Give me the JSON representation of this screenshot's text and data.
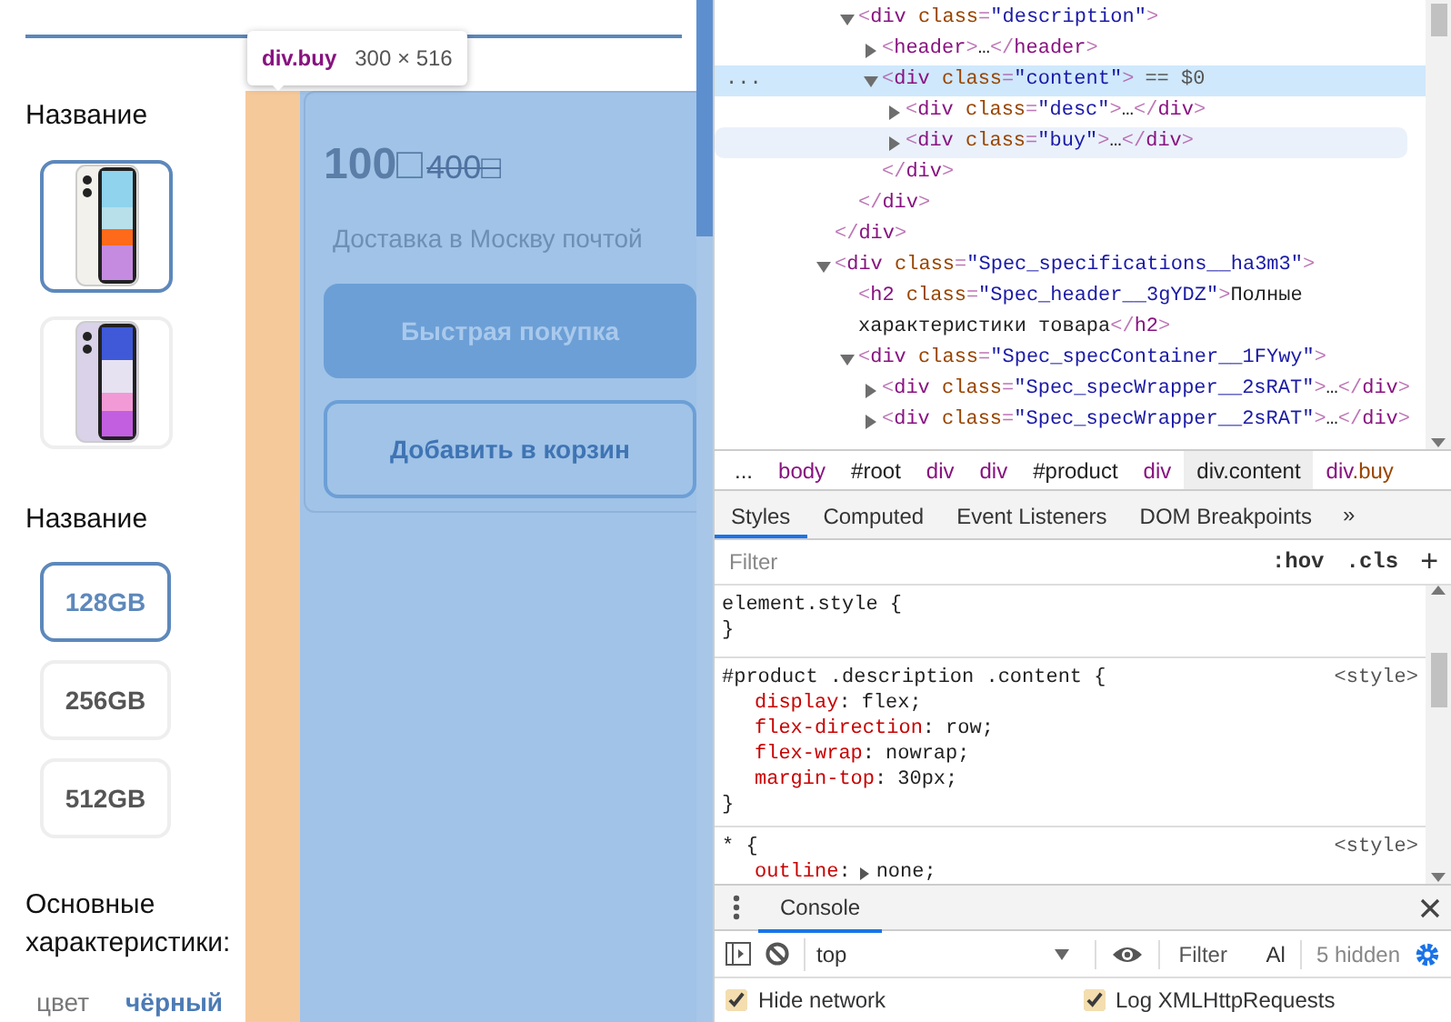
{
  "page": {
    "option_groups": [
      {
        "title": "Название",
        "kind": "image",
        "options": [
          {
            "color": "#f3f1ec",
            "selected": true
          },
          {
            "color": "#d9d2e9",
            "selected": false
          }
        ]
      },
      {
        "title": "Название",
        "kind": "text",
        "options": [
          {
            "label": "128GB",
            "selected": true
          },
          {
            "label": "256GB",
            "selected": false
          },
          {
            "label": "512GB",
            "selected": false
          }
        ]
      }
    ],
    "specs_title": "Основные характеристики:",
    "specs": [
      {
        "name": "цвет",
        "value": "чёрный"
      }
    ]
  },
  "inspect_tooltip": {
    "selector": "div.buy",
    "size": "300 × 516"
  },
  "buy_block": {
    "price": "100□",
    "old_price": "400□",
    "delivery": "Доставка в Москву почтой",
    "buttons": [
      {
        "label": "Быстрая покупка",
        "kind": "primary"
      },
      {
        "label": "Добавить в корзин",
        "kind": "outline"
      }
    ]
  },
  "devtools": {
    "elements_tree": [
      {
        "kind": "continuation",
        "close": "</div>",
        "children": [
          {
            "kind": "element",
            "line": "<div class=\"description\">",
            "expanded": true,
            "selected": false,
            "hovered": false,
            "close": "</div>",
            "children": [
              {
                "kind": "element",
                "line": "<header>…</header>",
                "expanded": false,
                "selected": false,
                "hovered": false
              },
              {
                "kind": "element",
                "line": "<div class=\"content\">",
                "suffix": "== $0",
                "gutter": "...",
                "expanded": true,
                "selected": true,
                "hovered": false,
                "close": "</div>",
                "children": [
                  {
                    "kind": "element",
                    "line": "<div class=\"desc\">…</div>",
                    "expanded": false,
                    "selected": false,
                    "hovered": false
                  },
                  {
                    "kind": "element",
                    "line": "<div class=\"buy\">…</div>",
                    "expanded": false,
                    "selected": false,
                    "hovered": true
                  }
                ]
              }
            ]
          }
        ]
      },
      {
        "kind": "element",
        "line": "<div class=\"Spec_specifications__ha3m3\">",
        "expanded": true,
        "selected": false,
        "hovered": false,
        "children": [
          {
            "kind": "leaf",
            "line": "<h2 class=\"Spec_header__3gYDZ\">Полные характеристики товара</h2>"
          },
          {
            "kind": "element",
            "line": "<div class=\"Spec_specContainer__1FYwy\">",
            "expanded": true,
            "selected": false,
            "hovered": false,
            "children": [
              {
                "kind": "element",
                "line": "<div class=\"Spec_specWrapper__2sRAT\">…</div>",
                "expanded": false,
                "selected": false,
                "hovered": false
              },
              {
                "kind": "element",
                "line": "<div class=\"Spec_specWrapper__2sRAT\">…</div>",
                "expanded": false,
                "selected": false,
                "hovered": false
              }
            ]
          }
        ]
      }
    ],
    "breadcrumbs": [
      {
        "parts": [
          {
            "text": "...",
            "kind": "plain"
          }
        ],
        "selected": false
      },
      {
        "parts": [
          {
            "text": "body",
            "kind": "tag"
          }
        ],
        "selected": false
      },
      {
        "parts": [
          {
            "text": "#root",
            "kind": "plain"
          }
        ],
        "selected": false
      },
      {
        "parts": [
          {
            "text": "div",
            "kind": "tag"
          }
        ],
        "selected": false
      },
      {
        "parts": [
          {
            "text": "div",
            "kind": "tag"
          }
        ],
        "selected": false
      },
      {
        "parts": [
          {
            "text": "#product",
            "kind": "plain"
          }
        ],
        "selected": false
      },
      {
        "parts": [
          {
            "text": "div",
            "kind": "tag"
          }
        ],
        "selected": false
      },
      {
        "parts": [
          {
            "text": "div.content",
            "kind": "plain"
          }
        ],
        "selected": true
      },
      {
        "parts": [
          {
            "text": "div",
            "kind": "tag"
          },
          {
            "text": ".buy",
            "kind": "class"
          }
        ],
        "selected": false
      }
    ],
    "tabs": [
      {
        "label": "Styles",
        "selected": true
      },
      {
        "label": "Computed",
        "selected": false
      },
      {
        "label": "Event Listeners",
        "selected": false
      },
      {
        "label": "DOM Breakpoints",
        "selected": false
      }
    ],
    "more_tabs": "»",
    "filter": {
      "placeholder": "Filter"
    },
    "filter_buttons": [
      ":hov",
      ".cls",
      "+"
    ],
    "rules": [
      {
        "selector": "element.style {",
        "close": "}"
      },
      {
        "selector": "#product .description .content {",
        "source": "<style>",
        "declarations": [
          {
            "name": "display",
            "colon": ":",
            "value": "flex;",
            "expandable": false
          },
          {
            "name": "flex-direction",
            "colon": ":",
            "value": "row;",
            "expandable": false
          },
          {
            "name": "flex-wrap",
            "colon": ":",
            "value": "nowrap;",
            "expandable": false
          },
          {
            "name": "margin-top",
            "colon": ":",
            "value": "30px;",
            "expandable": false
          }
        ],
        "close": "}"
      },
      {
        "selector": "* {",
        "source": "<style>",
        "declarations": [
          {
            "name": "outline",
            "colon": ":",
            "value": "none;",
            "expandable": true
          }
        ]
      }
    ],
    "drawer": {
      "tabs": [
        {
          "label": "Console",
          "selected": true
        }
      ],
      "context": "top",
      "filter": {
        "placeholder": "Filter"
      },
      "levels": "Al",
      "hidden": "5 hidden",
      "options": [
        {
          "label": "Hide network",
          "checked": true
        },
        {
          "label": "Log XMLHttpRequests",
          "checked": true
        }
      ]
    }
  }
}
